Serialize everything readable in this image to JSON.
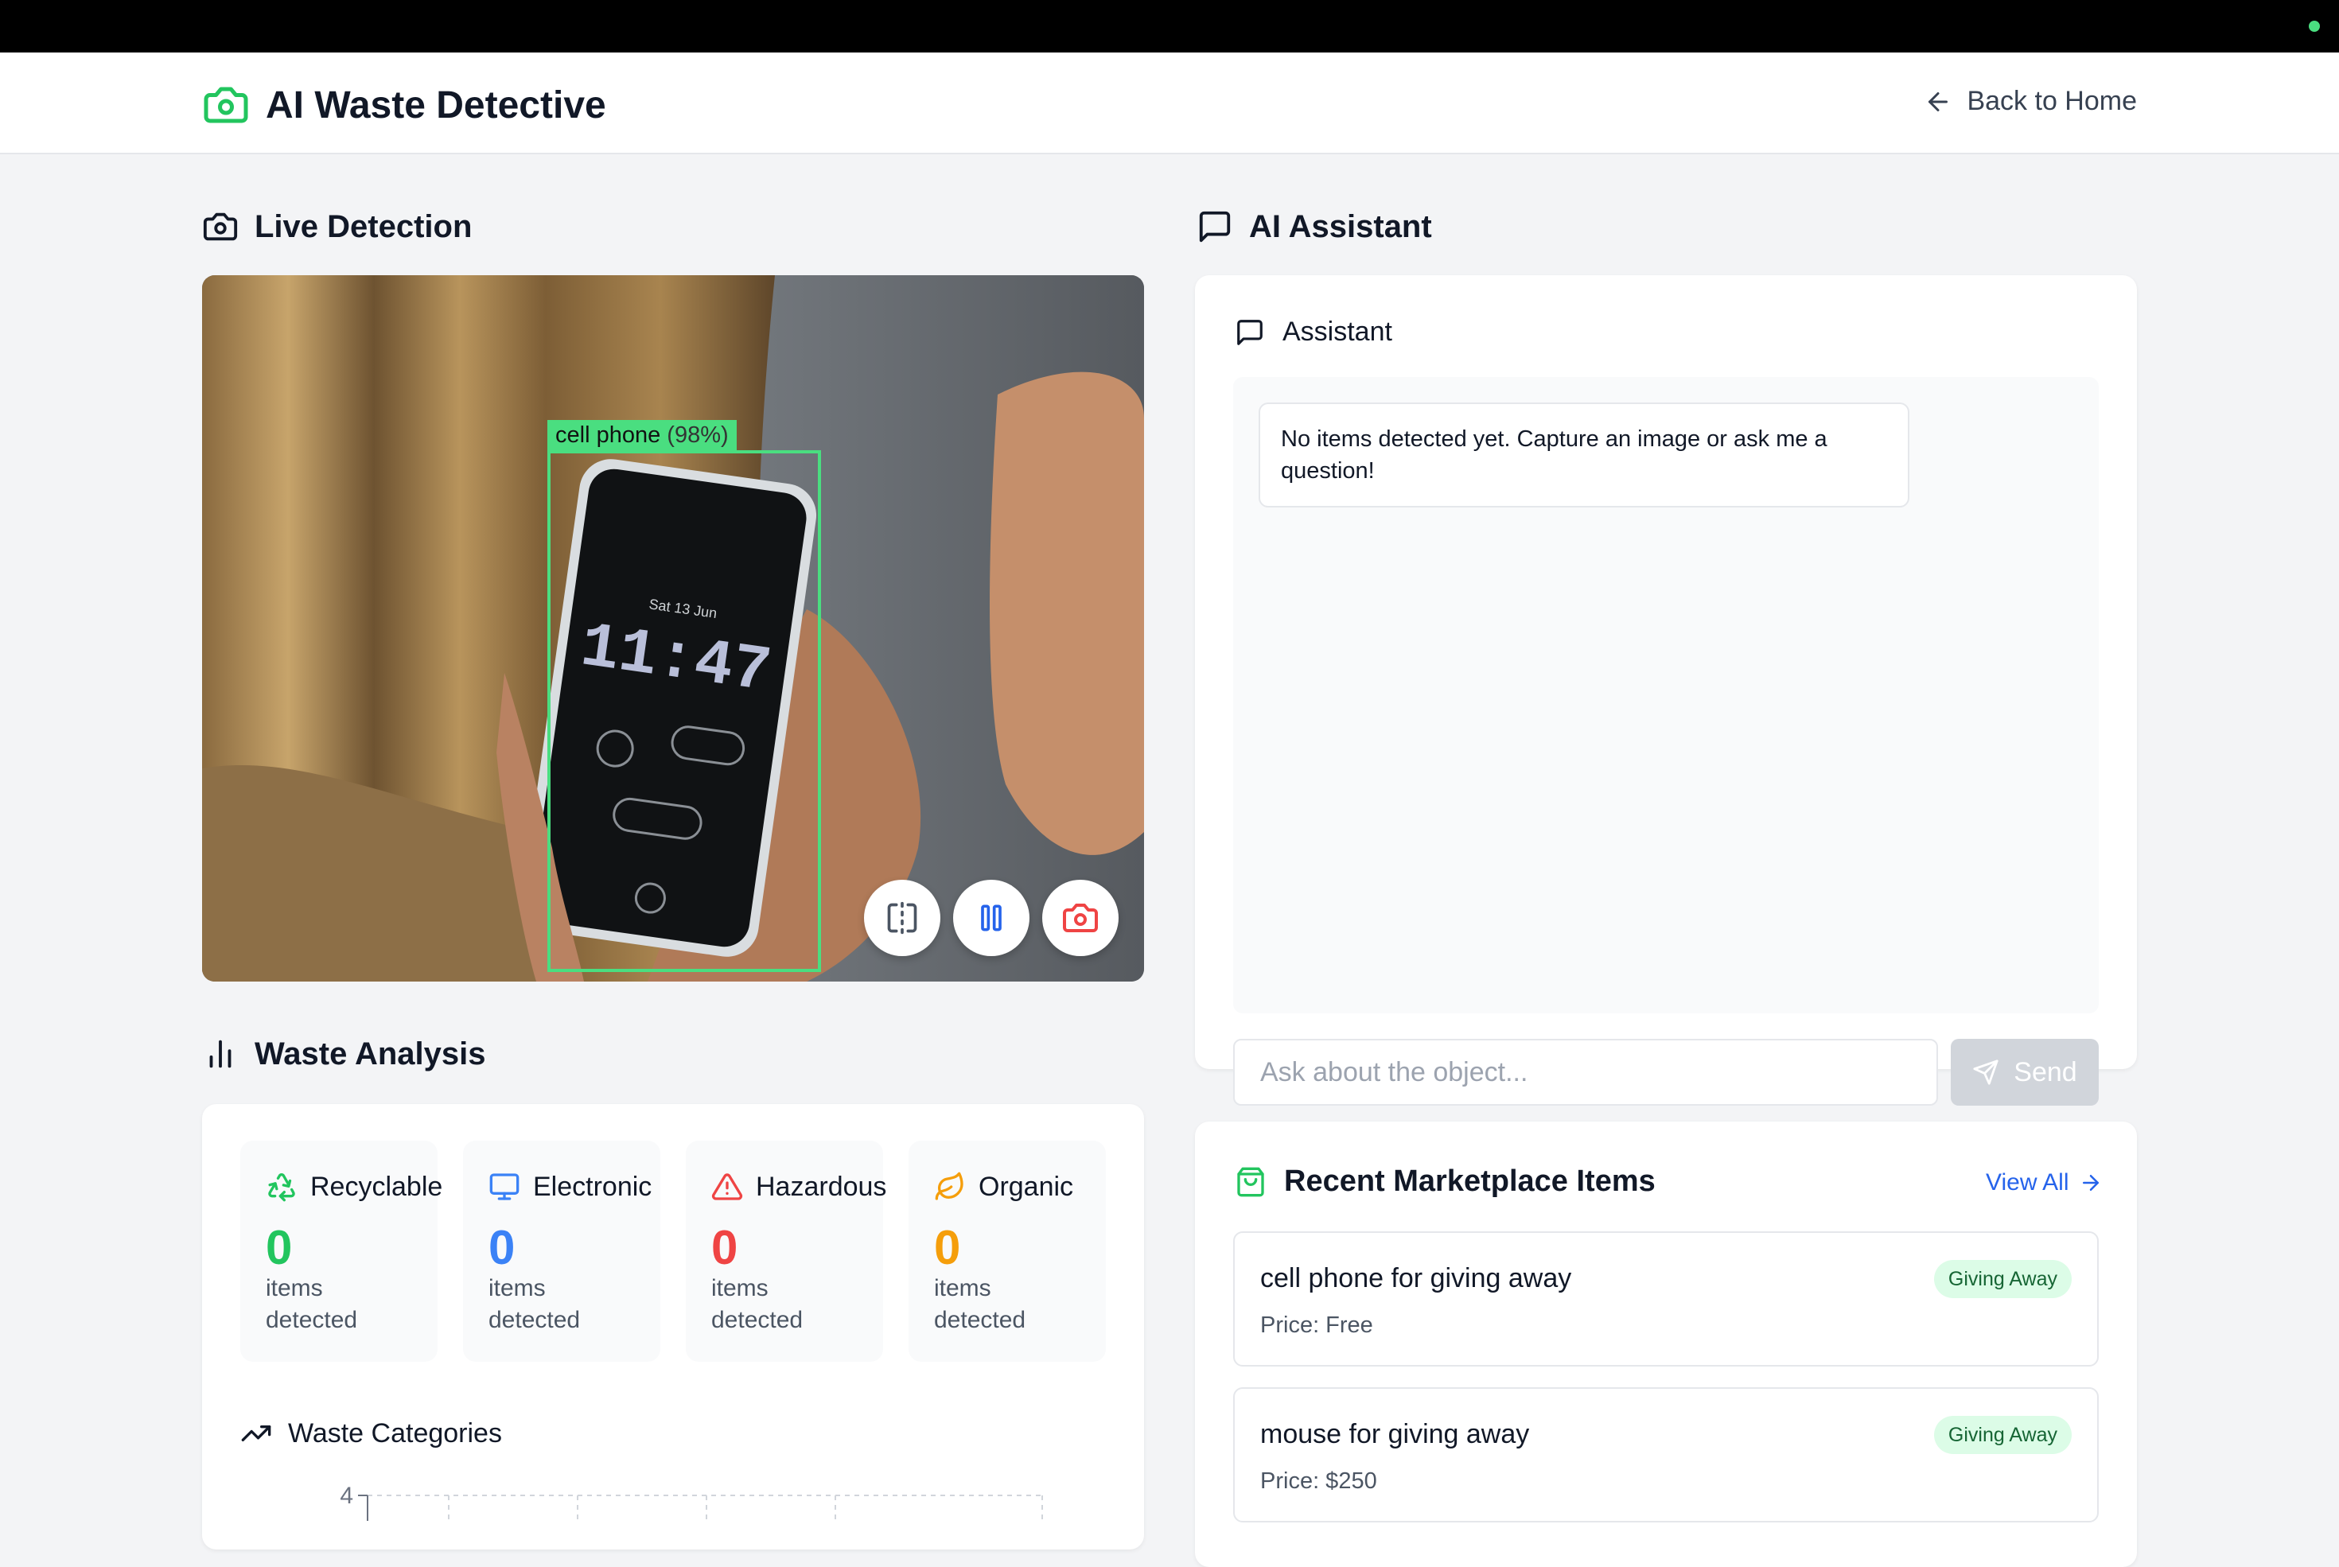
{
  "app": {
    "title": "AI Waste Detective",
    "back_label": "Back to Home"
  },
  "live_detection": {
    "title": "Live Detection",
    "detection_label": "cell phone",
    "detection_confidence": "(98%)",
    "phone_date": "Sat 13 Jun",
    "phone_time": "11:47"
  },
  "waste_analysis": {
    "title": "Waste Analysis",
    "stats": [
      {
        "label": "Recyclable",
        "count": "0",
        "caption": "items detected",
        "color": "#22c55e",
        "icon": "recycle-icon"
      },
      {
        "label": "Electronic",
        "count": "0",
        "caption": "items detected",
        "color": "#3b82f6",
        "icon": "monitor-icon"
      },
      {
        "label": "Hazardous",
        "count": "0",
        "caption": "items detected",
        "color": "#ef4444",
        "icon": "warning-triangle-icon"
      },
      {
        "label": "Organic",
        "count": "0",
        "caption": "items detected",
        "color": "#f59e0b",
        "icon": "leaf-icon"
      }
    ],
    "chart_title": "Waste Categories"
  },
  "chart_data": {
    "type": "bar",
    "title": "Waste Categories",
    "categories": [],
    "values": [],
    "ylim": [
      0,
      4
    ],
    "y_ticks_visible": [
      "4"
    ],
    "grid": true
  },
  "assistant": {
    "section_title": "AI Assistant",
    "card_title": "Assistant",
    "message": "No items detected yet. Capture an image or ask me a question!",
    "input_placeholder": "Ask about the object...",
    "send_label": "Send"
  },
  "marketplace": {
    "title": "Recent Marketplace Items",
    "view_all": "View All",
    "items": [
      {
        "name": "cell phone for giving away",
        "price": "Price: Free",
        "badge": "Giving Away"
      },
      {
        "name": "mouse for giving away",
        "price": "Price: $250",
        "badge": "Giving Away"
      }
    ]
  },
  "colors": {
    "brand": "#22c55e",
    "accent": "#2563eb",
    "record": "#ef4444"
  }
}
